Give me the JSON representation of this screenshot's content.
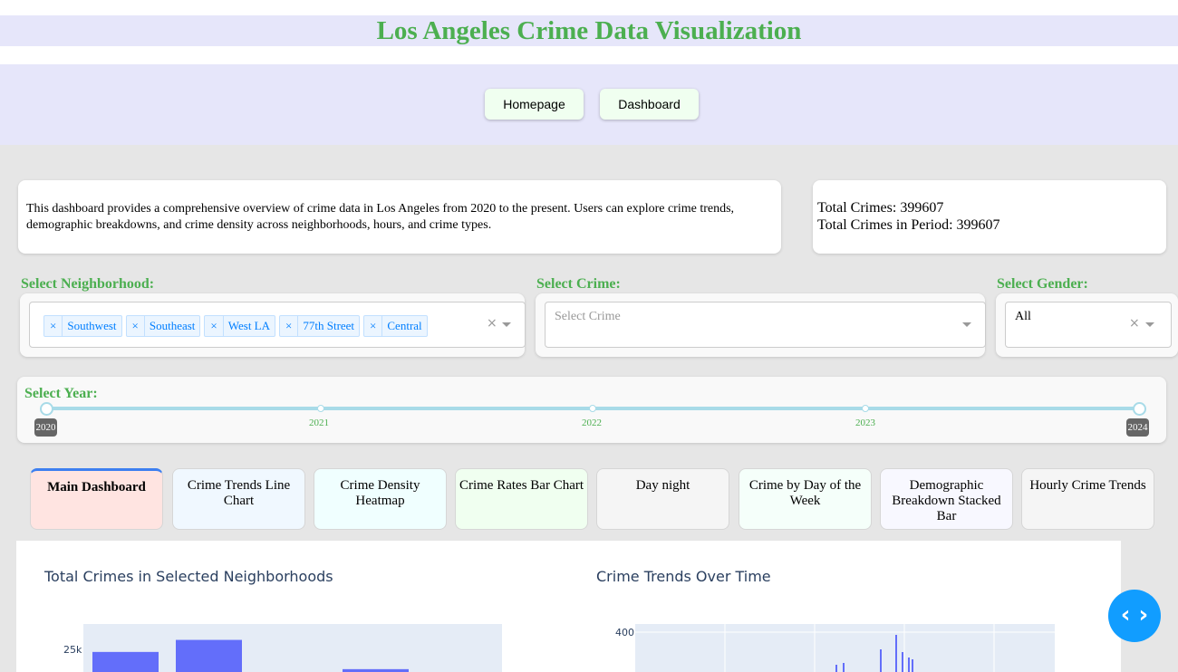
{
  "app": {
    "title": "Los Angeles Crime Data Visualization"
  },
  "nav": {
    "items": [
      {
        "label": "Homepage"
      },
      {
        "label": "Dashboard"
      }
    ]
  },
  "description": {
    "text": "This dashboard provides a comprehensive overview of crime data in Los Angeles from 2020 to the present. Users can explore crime trends, demographic breakdowns, and crime density across neighborhoods, hours, and crime types."
  },
  "totals": {
    "total_crimes": "Total Crimes: 399607",
    "total_in_period": "Total Crimes in Period: 399607"
  },
  "filters": {
    "neighborhood": {
      "label": "Select Neighborhood:",
      "selected": [
        "Southwest",
        "Southeast",
        "West LA",
        "77th Street",
        "Central"
      ]
    },
    "crime": {
      "label": "Select Crime:",
      "placeholder": "Select Crime"
    },
    "gender": {
      "label": "Select Gender:",
      "value": "All"
    },
    "year": {
      "label": "Select Year:",
      "marks": [
        "2021",
        "2022",
        "2023"
      ],
      "range_min": "2020",
      "range_max": "2024",
      "selected_range": [
        2020,
        2024
      ]
    }
  },
  "tabs": [
    {
      "label": "Main Dashboard",
      "selected": true,
      "color": "#ffe4e1"
    },
    {
      "label": "Crime Trends Line Chart",
      "selected": false,
      "color": "#f0f8ff"
    },
    {
      "label": "Crime Density Heatmap",
      "selected": false,
      "color": "#f0ffff"
    },
    {
      "label": "Crime Rates Bar Chart",
      "selected": false,
      "color": "#f0fff0"
    },
    {
      "label": "Day night",
      "selected": false,
      "color": "#f5f5f5"
    },
    {
      "label": "Crime by Day of the Week",
      "selected": false,
      "color": "#f5fffa"
    },
    {
      "label": "Demographic Breakdown Stacked Bar",
      "selected": false,
      "color": "#f8f8ff"
    },
    {
      "label": "Hourly Crime Trends",
      "selected": false,
      "color": "#f5f5f5"
    }
  ],
  "charts": {
    "left_title": "Total Crimes in Selected Neighborhoods",
    "right_title": "Crime Trends Over Time",
    "left_ytick": "25k",
    "right_ytick": "400"
  },
  "chart_data": [
    {
      "type": "bar",
      "title": "Total Crimes in Selected Neighborhoods",
      "yticks": [
        "25k"
      ],
      "values_visible": [
        24700,
        26100,
        null,
        22700,
        null
      ],
      "color": "#636efa"
    },
    {
      "type": "line",
      "title": "Crime Trends Over Time",
      "yticks": [
        "400"
      ],
      "color": "#636efa"
    }
  ],
  "colors": {
    "accent_green": "#4caf50",
    "header_bg": "#e6e6fa",
    "plotly_blue": "#636efa",
    "fab_blue": "#119dff",
    "slider_track": "#a8dbe8"
  },
  "icons": {
    "fab": "code-brackets-icon"
  }
}
